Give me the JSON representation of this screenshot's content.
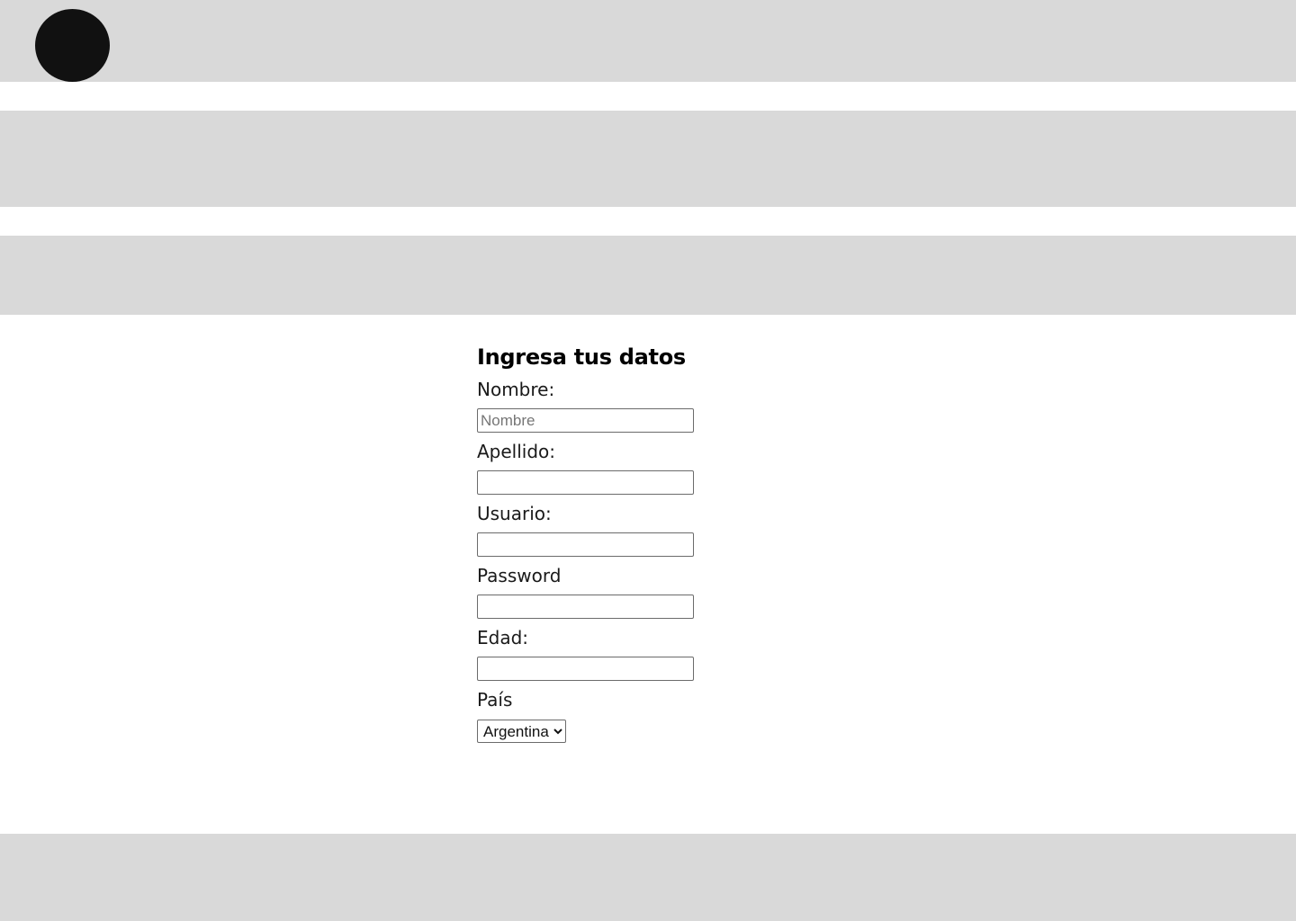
{
  "form": {
    "title": "Ingresa tus datos",
    "fields": [
      {
        "label": "Nombre:",
        "placeholder": "Nombre",
        "value": ""
      },
      {
        "label": "Apellido:",
        "placeholder": "",
        "value": ""
      },
      {
        "label": "Usuario:",
        "placeholder": "",
        "value": ""
      },
      {
        "label": "Password",
        "placeholder": "",
        "value": ""
      },
      {
        "label": "Edad:",
        "placeholder": "",
        "value": ""
      }
    ],
    "country": {
      "label": "País",
      "selected": "Argentina"
    }
  },
  "colors": {
    "band": "#d9d9d9",
    "logo": "#111111",
    "background": "#ffffff"
  }
}
